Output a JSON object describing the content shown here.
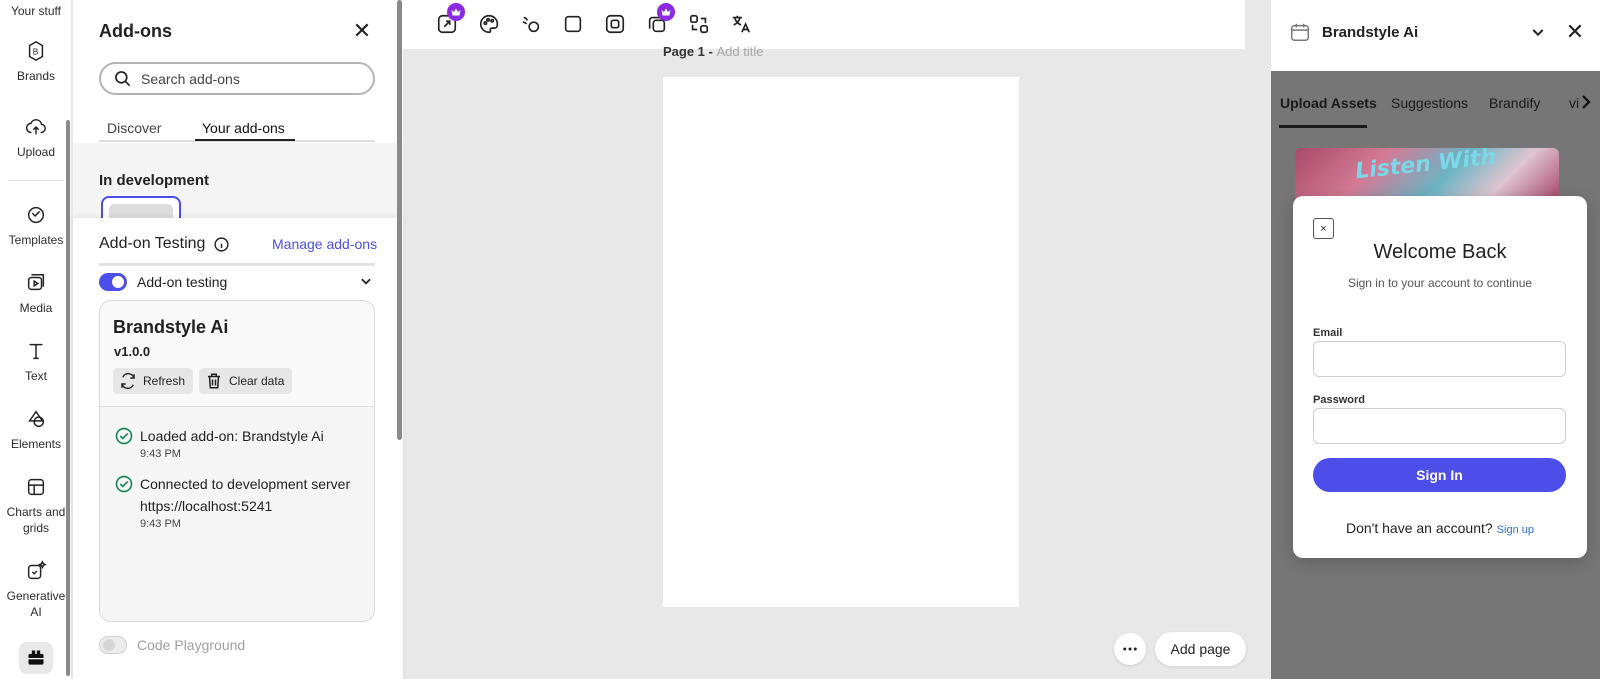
{
  "rail": {
    "items": [
      {
        "label": "Your stuff",
        "icon": "your-stuff-icon"
      },
      {
        "label": "Brands",
        "icon": "brands-icon"
      },
      {
        "label": "Upload",
        "icon": "upload-icon"
      },
      {
        "label": "Templates",
        "icon": "templates-icon"
      },
      {
        "label": "Media",
        "icon": "media-icon"
      },
      {
        "label": "Text",
        "icon": "text-icon"
      },
      {
        "label": "Elements",
        "icon": "elements-icon"
      },
      {
        "label": "Charts and grids",
        "icon": "charts-grids-icon"
      },
      {
        "label": "Generative AI",
        "icon": "generative-ai-icon"
      }
    ]
  },
  "addons": {
    "title": "Add-ons",
    "search_placeholder": "Search add-ons",
    "tabs": [
      {
        "label": "Discover",
        "active": false
      },
      {
        "label": "Your add-ons",
        "active": true
      }
    ],
    "in_development": "In development"
  },
  "testing": {
    "title": "Add-on Testing",
    "manage_link": "Manage add-ons",
    "toggle_label": "Add-on testing",
    "toggle_on": true,
    "card": {
      "name": "Brandstyle Ai",
      "version": "v1.0.0",
      "refresh_label": "Refresh",
      "clear_label": "Clear data",
      "logs": [
        {
          "line1": "Loaded add-on: Brandstyle Ai",
          "line2": "",
          "time": "9:43 PM"
        },
        {
          "line1": "Connected to development server",
          "line2": "https://localhost:5241",
          "time": "9:43 PM"
        }
      ]
    },
    "code_playground_label": "Code Playground",
    "code_playground_on": false
  },
  "canvas": {
    "page_prefix": "Page 1 - ",
    "page_title_placeholder": "Add title",
    "add_page_label": "Add page"
  },
  "right_panel": {
    "title": "Brandstyle Ai",
    "tabs": [
      "Upload Assets",
      "Suggestions",
      "Brandify",
      "vi"
    ],
    "active_tab": "Upload Assets",
    "preview_text": "Listen With"
  },
  "modal": {
    "close_label": "×",
    "title": "Welcome Back",
    "subtitle": "Sign in to your account to continue",
    "email_label": "Email",
    "password_label": "Password",
    "signin_label": "Sign In",
    "signup_prompt": "Don't have an account?",
    "signup_link": "Sign up"
  },
  "colors": {
    "accent": "#4b4ee8",
    "premium": "#8a2be2",
    "overlay": "#767676",
    "success": "#1a8a5a"
  }
}
